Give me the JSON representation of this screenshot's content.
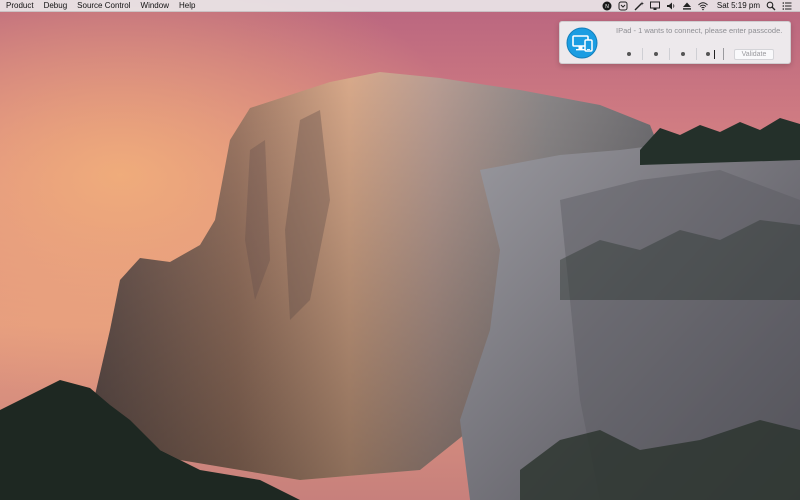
{
  "menubar": {
    "items": [
      "Product",
      "Debug",
      "Source Control",
      "Window",
      "Help"
    ],
    "clock": "Sat 5:19 pm",
    "status_icons": [
      "status-app-icon",
      "dropbox-icon",
      "wand-icon",
      "display-icon",
      "volume-icon",
      "eject-icon",
      "wifi-icon",
      "user-icon",
      "search-icon",
      "notification-center-icon"
    ]
  },
  "notification": {
    "message": "IPad - 1 wants to connect, please enter passcode.",
    "passcode_digits": [
      "•",
      "•",
      "•",
      "•"
    ],
    "validate_label": "Validate",
    "accent_color": "#1b9de2"
  }
}
